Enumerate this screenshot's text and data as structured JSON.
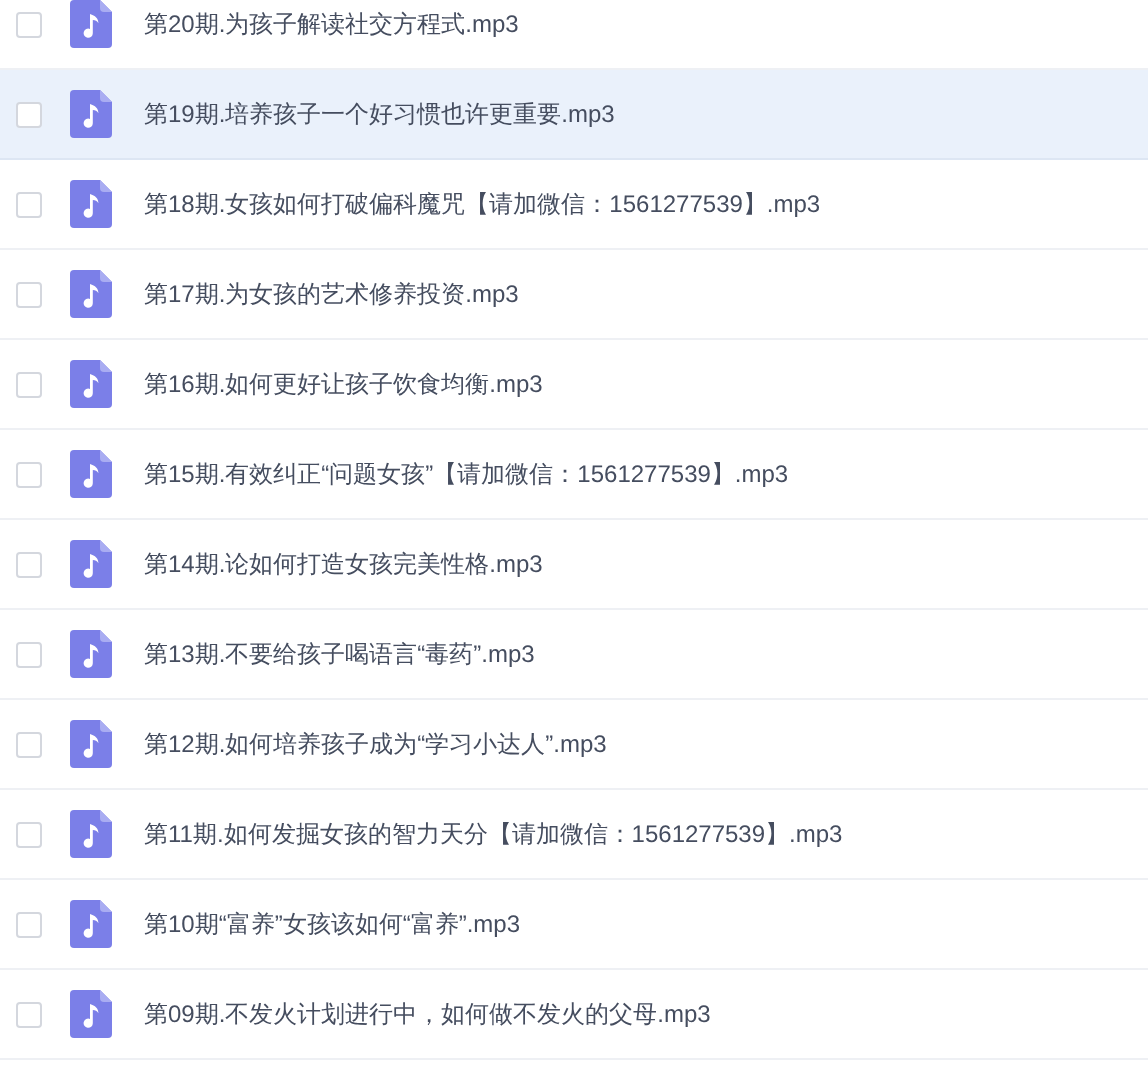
{
  "files": [
    {
      "name": "第20期.为孩子解读社交方程式.mp3",
      "checked": false,
      "highlighted": false
    },
    {
      "name": "第19期.培养孩子一个好习惯也许更重要.mp3",
      "checked": false,
      "highlighted": true
    },
    {
      "name": "第18期.女孩如何打破偏科魔咒【请加微信：1561277539】.mp3",
      "checked": false,
      "highlighted": false
    },
    {
      "name": "第17期.为女孩的艺术修养投资.mp3",
      "checked": false,
      "highlighted": false
    },
    {
      "name": "第16期.如何更好让孩子饮食均衡.mp3",
      "checked": false,
      "highlighted": false
    },
    {
      "name": "第15期.有效纠正“问题女孩”【请加微信：1561277539】.mp3",
      "checked": false,
      "highlighted": false
    },
    {
      "name": "第14期.论如何打造女孩完美性格.mp3",
      "checked": false,
      "highlighted": false
    },
    {
      "name": "第13期.不要给孩子喝语言“毒药”.mp3",
      "checked": false,
      "highlighted": false
    },
    {
      "name": "第12期.如何培养孩子成为“学习小达人”.mp3",
      "checked": false,
      "highlighted": false
    },
    {
      "name": "第11期.如何发掘女孩的智力天分【请加微信：1561277539】.mp3",
      "checked": false,
      "highlighted": false
    },
    {
      "name": "第10期“富养”女孩该如何“富养”.mp3",
      "checked": false,
      "highlighted": false
    },
    {
      "name": "第09期.不发火计划进行中，如何做不发火的父母.mp3",
      "checked": false,
      "highlighted": false
    }
  ]
}
